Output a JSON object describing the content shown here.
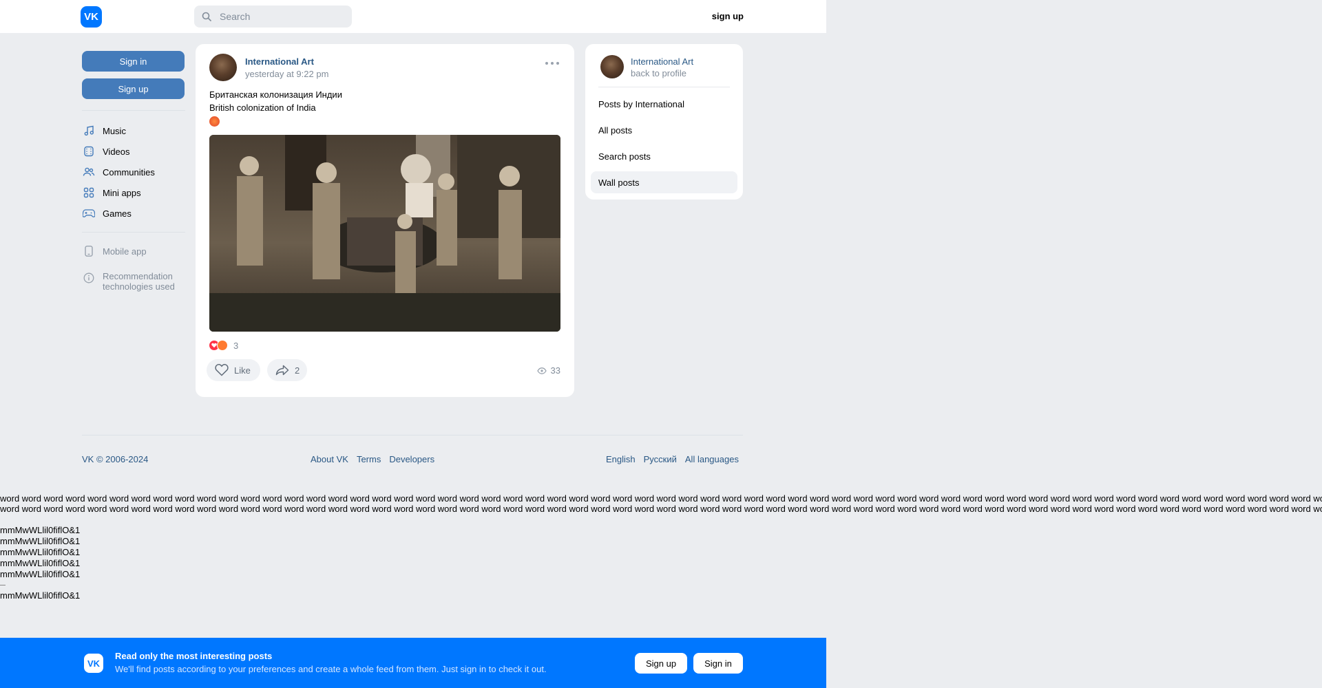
{
  "header": {
    "logo_text": "VK",
    "search_placeholder": "Search",
    "signup_label": "sign up"
  },
  "left": {
    "signin_label": "Sign in",
    "signup_label": "Sign up",
    "nav": [
      {
        "label": "Music",
        "icon": "music-note-icon"
      },
      {
        "label": "Videos",
        "icon": "video-icon"
      },
      {
        "label": "Communities",
        "icon": "users-icon"
      },
      {
        "label": "Mini apps",
        "icon": "apps-grid-icon"
      },
      {
        "label": "Games",
        "icon": "gamepad-icon"
      }
    ],
    "mobile_app": "Mobile app",
    "recommendation": "Recommendation technologies used"
  },
  "post": {
    "author": "International Art",
    "time": "yesterday at 9:22 pm",
    "text_ru": "Британская колонизация Индии",
    "text_en": "British colonization of India",
    "reactions_count": "3",
    "like_label": "Like",
    "share_count": "2",
    "views": "33"
  },
  "right": {
    "name": "International Art",
    "back": "back to profile",
    "items": [
      "Posts by International",
      "All posts",
      "Search posts",
      "Wall posts"
    ],
    "active_item": "Wall posts"
  },
  "footer": {
    "copyright": "VK © 2006-2024",
    "links": [
      "About VK",
      "Terms",
      "Developers"
    ],
    "languages": [
      "English",
      "Русский",
      "All languages"
    ]
  },
  "filler": {
    "word_line": "word word word word word word word word word word word word word word word word word word word word word word word word word word word word word word word word word word word word word word word word word word word word word word word word word word word word word word word word word word word word word word word",
    "glyph_line": "mmMwWLlil0fiflO&1"
  },
  "banner": {
    "title": "Read only the most interesting posts",
    "subtitle": "We'll find posts according to your preferences and create a whole feed from them. Just sign in to check it out.",
    "signup_label": "Sign up",
    "signin_label": "Sign in"
  },
  "colors": {
    "brand": "#0077ff",
    "link": "#2a5885",
    "button_blue": "#447bba",
    "background": "#ebedf0"
  }
}
